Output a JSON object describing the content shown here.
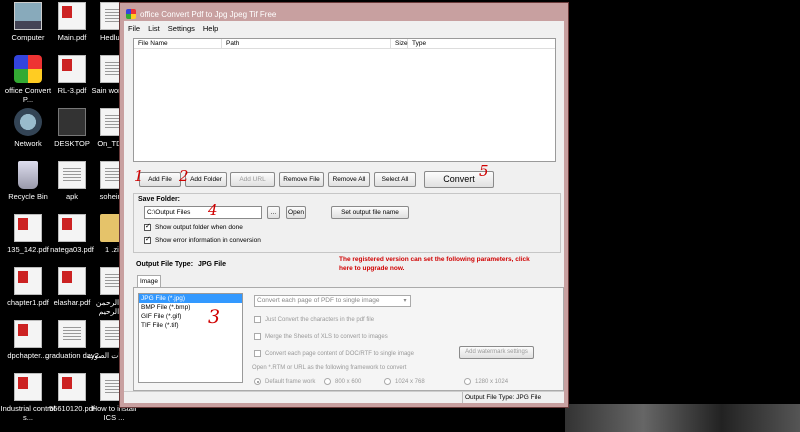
{
  "desktop": {
    "icons": [
      {
        "label": "Computer",
        "icon": "computer-icon"
      },
      {
        "label": "Main.pdf",
        "icon": "pdf-file-icon"
      },
      {
        "label": "Hedlund",
        "icon": "document-icon"
      },
      {
        "label": "office Convert P...",
        "icon": "app-icon"
      },
      {
        "label": "RL-3.pdf",
        "icon": "pdf-file-icon"
      },
      {
        "label": "Sain worksho",
        "icon": "document-icon"
      },
      {
        "label": "Network",
        "icon": "network-icon"
      },
      {
        "label": "DESKTOP",
        "icon": "folder-icon"
      },
      {
        "label": "On_TD_A",
        "icon": "document-icon"
      },
      {
        "label": "Recycle Bin",
        "icon": "recycle-bin-icon"
      },
      {
        "label": "apk",
        "icon": "document-icon"
      },
      {
        "label": "soheir20",
        "icon": "document-icon"
      },
      {
        "label": "135_142.pdf",
        "icon": "pdf-file-icon"
      },
      {
        "label": "natega03.pdf",
        "icon": "pdf-file-icon"
      },
      {
        "label": "1 .zip",
        "icon": "zip-file-icon"
      },
      {
        "label": "chapter1.pdf",
        "icon": "pdf-file-icon"
      },
      {
        "label": "elashar.pdf",
        "icon": "pdf-file-icon"
      },
      {
        "label": "الله الرحمن الرحيم .di",
        "icon": "word-document-icon"
      },
      {
        "label": "dpchapter....",
        "icon": "pdf-file-icon"
      },
      {
        "label": "graduation day2",
        "icon": "document-icon"
      },
      {
        "label": "مستحبات الصوت",
        "icon": "document-icon"
      },
      {
        "label": "Industrial control s...",
        "icon": "pdf-file-icon"
      },
      {
        "label": "55610120.pdf",
        "icon": "pdf-file-icon"
      },
      {
        "label": "How to install ICS ...",
        "icon": "document-icon"
      }
    ]
  },
  "window": {
    "title": "office Convert Pdf to Jpg Jpeg Tif Free",
    "menu": [
      "File",
      "List",
      "Settings",
      "Help"
    ],
    "columns": [
      "File Name",
      "Path",
      "Size",
      "Type"
    ],
    "buttons": {
      "add_file": "Add File",
      "add_folder": "Add Folder",
      "add_url": "Add URL",
      "remove_file": "Remove File",
      "remove_all": "Remove All",
      "select_all": "Select All",
      "convert": "Convert"
    },
    "save_folder": {
      "label": "Save Folder:",
      "value": "C:\\Output Files",
      "browse": "...",
      "open": "Open",
      "set_output_name": "Set output file name",
      "show_output_folder": "Show output folder when done",
      "show_error_info": "Show error information in conversion"
    },
    "output_type": {
      "label": "Output File Type:",
      "value": "JPG File"
    },
    "upgrade_notice": "The registered version can set the following parameters, click here to upgrade now.",
    "tab_label": "Image",
    "file_types": [
      "JPG File (*.jpg)",
      "BMP File (*.bmp)",
      "GIF File (*.gif)",
      "TIF File (*.tif)"
    ],
    "selected_file_type": "JPG File (*.jpg)",
    "page_mode": "Convert each page of PDF to single image",
    "options": {
      "just_convert_chars": "Just Convert the characters in the pdf file",
      "merge_sheets": "Merge the Sheets of XLS to convert to images",
      "convert_doc_pages": "Convert each page content of DOC/RTF to single image",
      "add_watermark": "Add watermark settings",
      "frame_caption": "Open *.RTM or URL as the following framework to convert",
      "frames": [
        "Default frame work",
        "800 x 600",
        "1024 x 768",
        "1280 x 1024"
      ]
    },
    "status": {
      "left": "",
      "right": "Output File Type:  JPG File"
    }
  },
  "annotations": [
    "1",
    "2",
    "3",
    "4",
    "5"
  ]
}
